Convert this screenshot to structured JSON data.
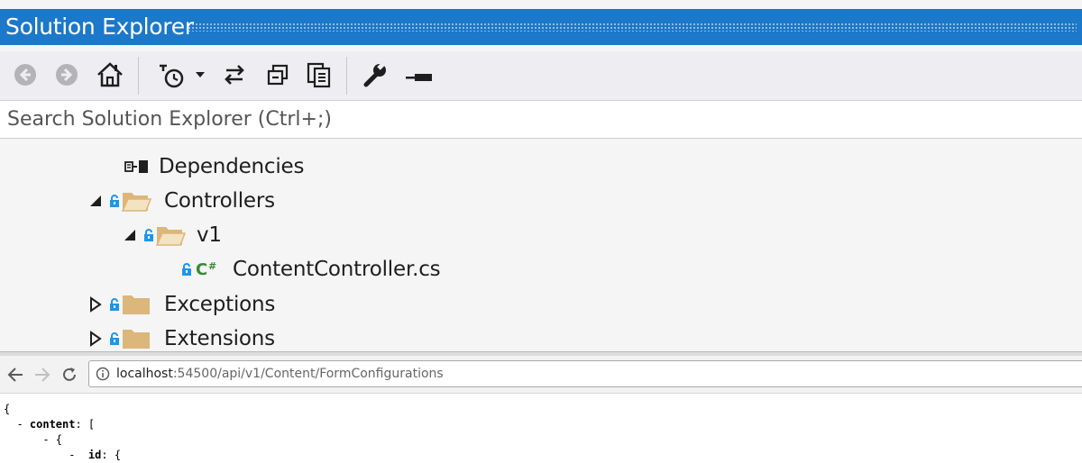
{
  "panel": {
    "title": "Solution Explorer",
    "search_placeholder": "Search Solution Explorer (Ctrl+;)"
  },
  "toolbar": {
    "buttons": [
      "back-icon",
      "forward-icon",
      "home-icon",
      "pending-changes-filter-icon",
      "sync-active-document-icon",
      "collapse-all-icon",
      "show-all-files-icon",
      "properties-icon",
      "preview-selected-items-icon"
    ]
  },
  "tree": {
    "items": [
      {
        "label": "Dependencies",
        "icon": "dependencies-icon"
      },
      {
        "label": "Controllers",
        "icon": "folder-open-icon",
        "expanded": true
      },
      {
        "label": "v1",
        "icon": "folder-open-icon",
        "expanded": true
      },
      {
        "label": "ContentController.cs",
        "icon": "csharp-file-icon"
      },
      {
        "label": "Exceptions",
        "icon": "folder-icon",
        "expanded": false
      },
      {
        "label": "Extensions",
        "icon": "folder-icon",
        "expanded": false
      }
    ]
  },
  "browser": {
    "url_host": "localhost",
    "url_path": ":54500/api/v1/Content/FormConfigurations"
  },
  "json_view": {
    "line1": "{",
    "line2_prefix": "  - ",
    "line2_key": "content",
    "line2_suffix": ": [",
    "line3": "      - {",
    "line4_prefix": "          -  ",
    "line4_key": "id",
    "line4_suffix": ": {"
  },
  "colors": {
    "titlebar": "#1c78c8",
    "folder": "#dcb67a",
    "lock": "#1c97ea",
    "csharp": "#388a34"
  }
}
